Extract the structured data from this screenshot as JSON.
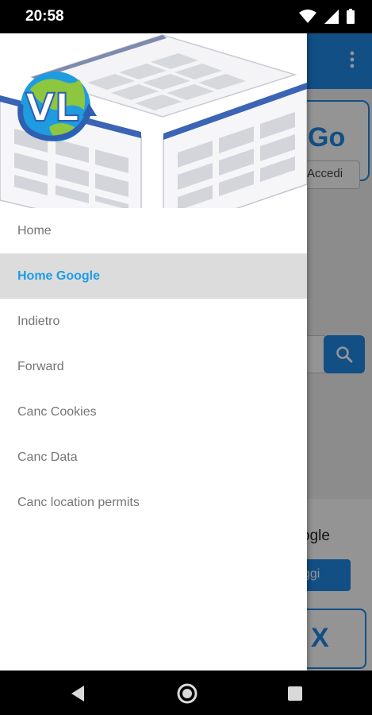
{
  "status_bar": {
    "time": "20:58",
    "icons": [
      "wifi-icon",
      "signal-icon",
      "battery-icon"
    ]
  },
  "background_app": {
    "go_label": "Go",
    "accedi_label": "Accedi",
    "ogle_text": "ogle",
    "oggi_label": "ggi",
    "x_label": "X"
  },
  "drawer": {
    "logo_text": "VL",
    "menu_items": [
      {
        "label": "Home",
        "selected": false
      },
      {
        "label": "Home Google",
        "selected": true
      },
      {
        "label": "Indietro",
        "selected": false
      },
      {
        "label": "Forward",
        "selected": false
      },
      {
        "label": "Canc Cookies",
        "selected": false
      },
      {
        "label": "Canc Data",
        "selected": false
      },
      {
        "label": "Canc location permits",
        "selected": false
      }
    ]
  },
  "nav_bar": {
    "icons": [
      "back-icon",
      "home-icon",
      "recents-icon"
    ]
  },
  "colors": {
    "accent": "#1e9ce8",
    "primary": "#1e88e5",
    "selected_bg": "#dcdcdc",
    "menu_text": "#757575"
  }
}
